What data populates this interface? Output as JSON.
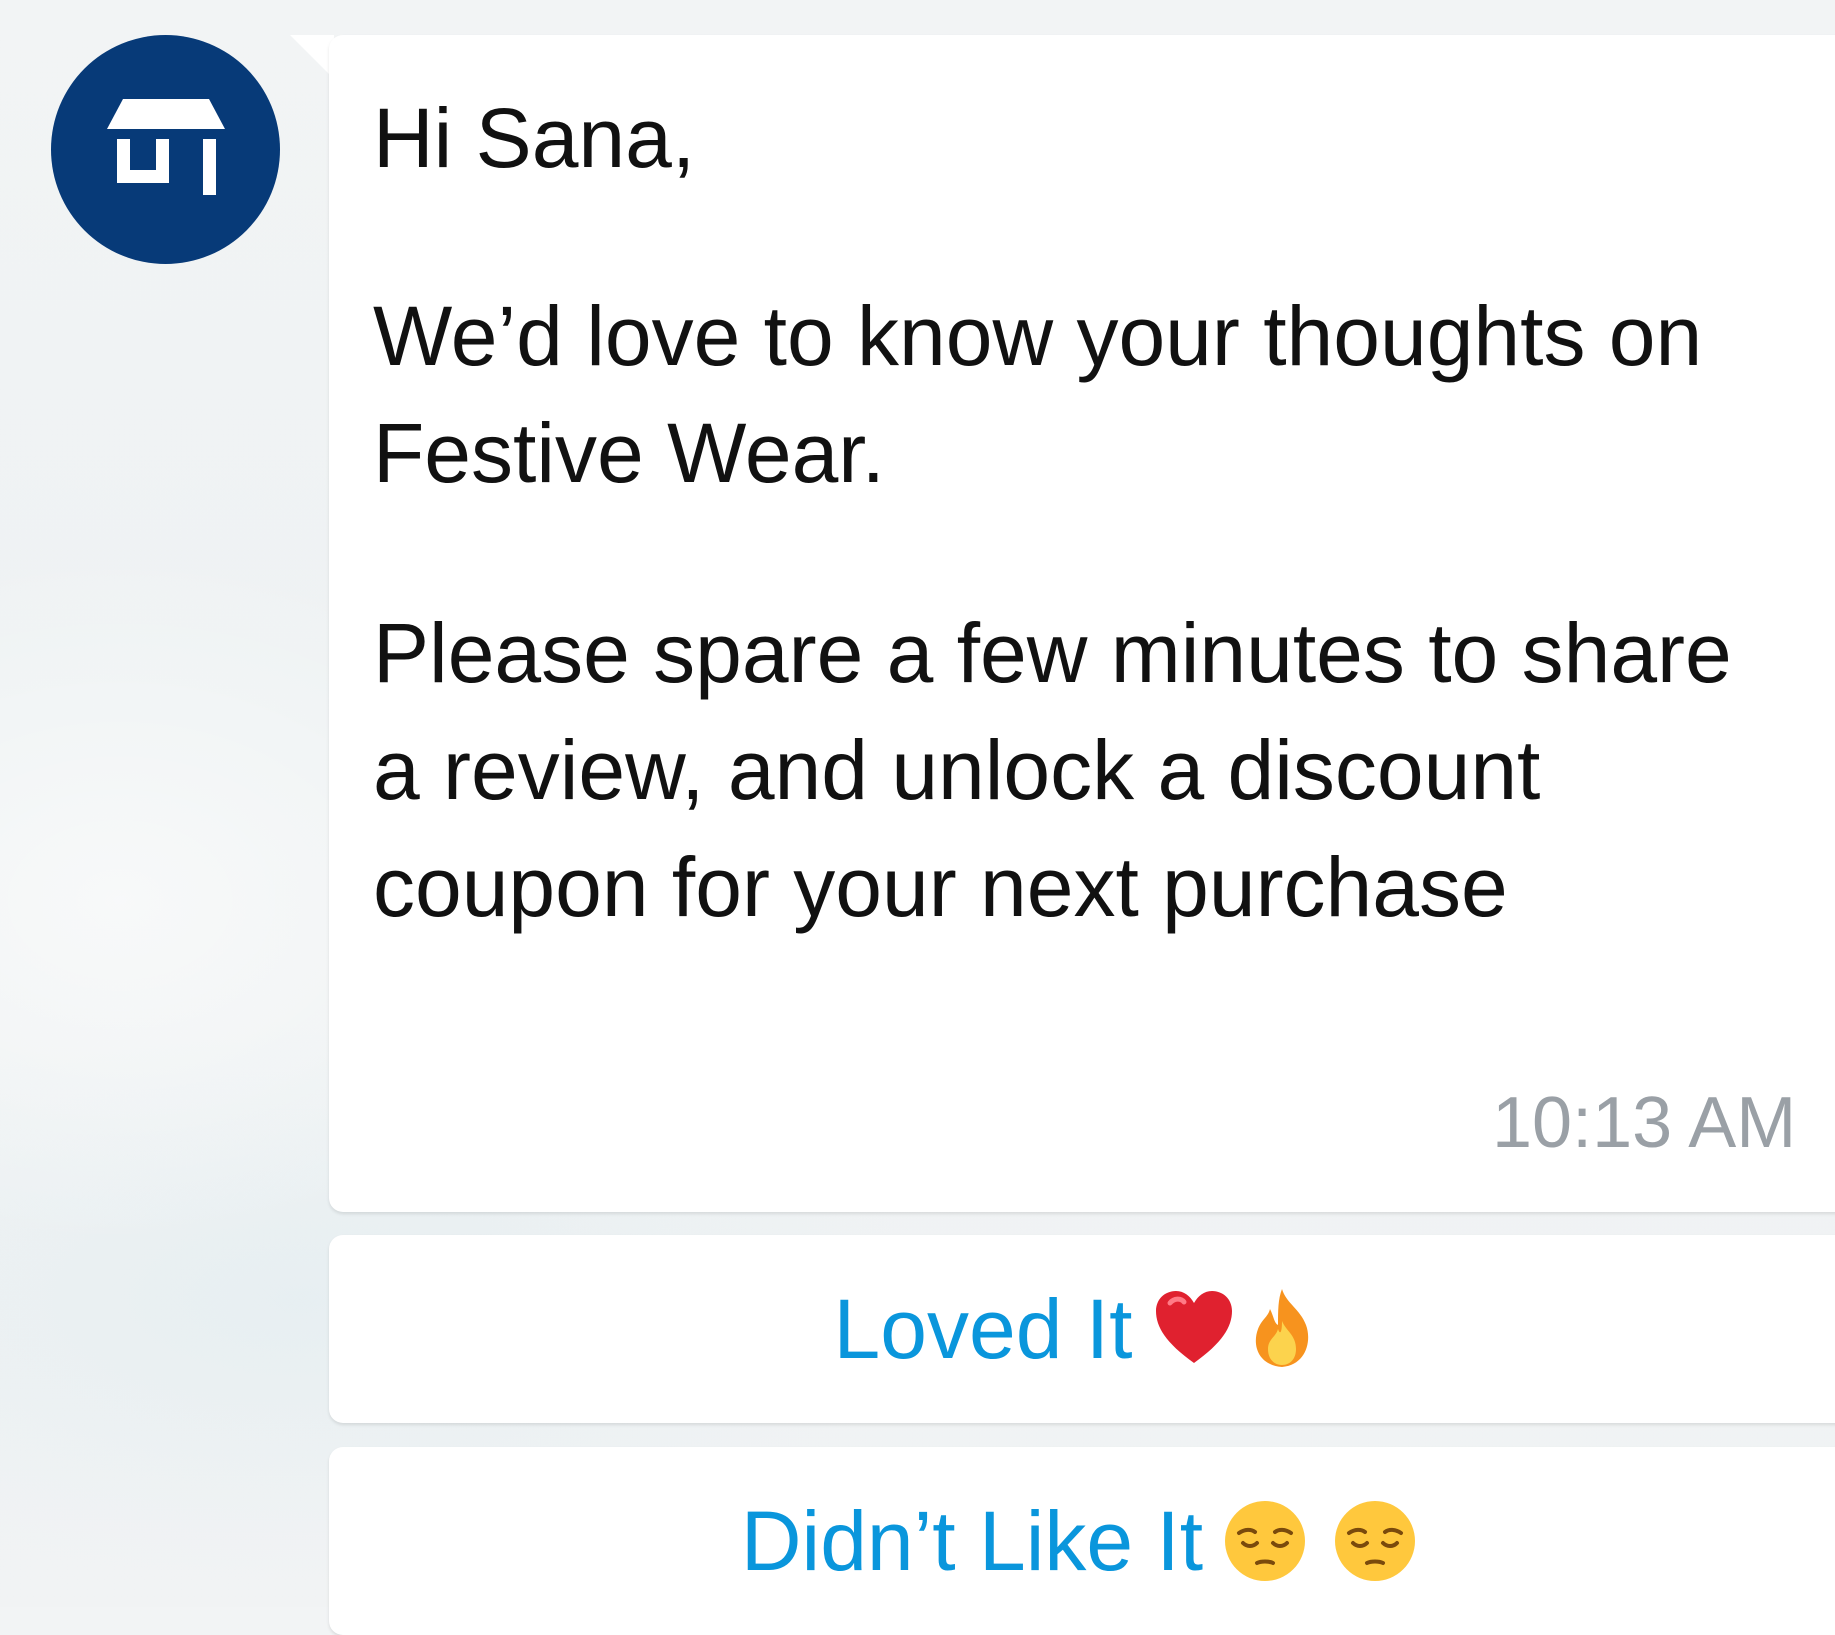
{
  "chat": {
    "sender_avatar_icon": "store-icon",
    "message": {
      "greeting": "Hi Sana,",
      "paragraph1": "We’d love to know your thoughts on Festive Wear.",
      "paragraph2": "Please spare a few minutes to share a review, and unlock a discount coupon for your next purchase",
      "timestamp": "10:13 AM"
    },
    "quick_replies": [
      {
        "label": "Loved It",
        "emojis": [
          "heart-emoji",
          "fire-emoji"
        ]
      },
      {
        "label": "Didn’t Like It",
        "emojis": [
          "pensive-face-emoji",
          "pensive-face-emoji"
        ]
      }
    ]
  },
  "colors": {
    "avatar_background": "#073a78",
    "message_text": "#111111",
    "timestamp_text": "#9aa0a6",
    "reply_text": "#0a96dc",
    "bubble_background": "#ffffff"
  }
}
